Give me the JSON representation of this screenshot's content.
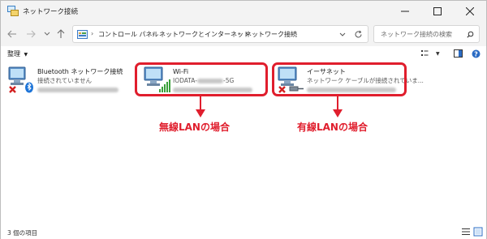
{
  "window": {
    "title": "ネットワーク接続"
  },
  "address": {
    "path": [
      "コントロール パネル",
      "ネットワークとインターネット",
      "ネットワーク接続"
    ],
    "search_placeholder": "ネットワーク接続の検索"
  },
  "toolbar": {
    "organize_label": "整理"
  },
  "connections": [
    {
      "name": "Bluetooth ネットワーク接続",
      "status": "接続されていません",
      "icon": "bluetooth-network-icon",
      "state": "disconnected"
    },
    {
      "name": "Wi-Fi",
      "status": "IODATA-",
      "status_suffix": "-5G",
      "icon": "wifi-network-icon",
      "state": "connected"
    },
    {
      "name": "イーサネット",
      "status": "ネットワーク ケーブルが接続されていま...",
      "icon": "ethernet-network-icon",
      "state": "disconnected"
    }
  ],
  "annotations": {
    "wireless_label": "無線LANの場合",
    "wired_label": "有線LANの場合",
    "accent_color": "#e01e2d"
  },
  "statusbar": {
    "item_count": "3 個の項目"
  }
}
